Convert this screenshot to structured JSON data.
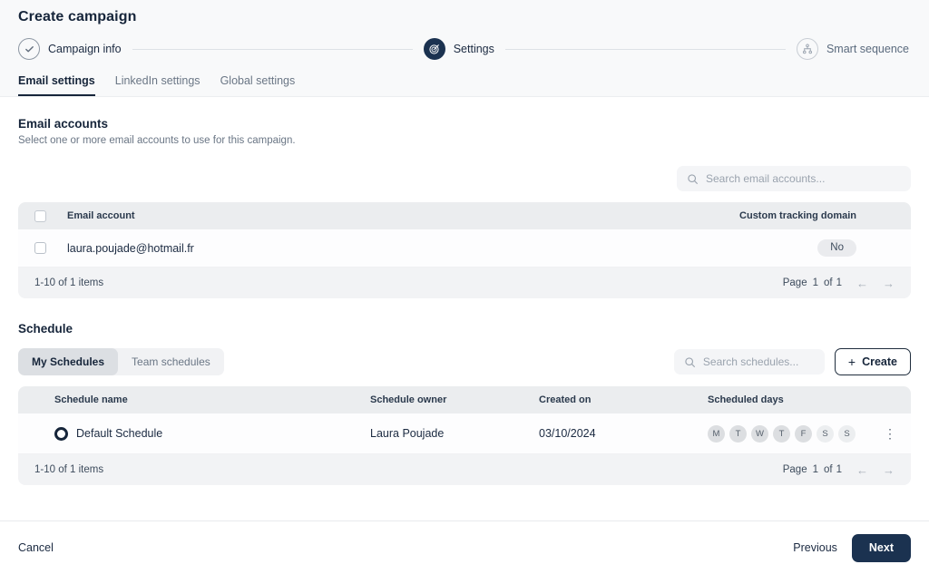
{
  "header": {
    "title": "Create campaign",
    "steps": [
      {
        "label": "Campaign info",
        "state": "done",
        "icon": "check-circle-icon"
      },
      {
        "label": "Settings",
        "state": "active",
        "icon": "target-icon"
      },
      {
        "label": "Smart sequence",
        "state": "upcoming",
        "icon": "sitemap-icon"
      }
    ],
    "tabs": [
      {
        "label": "Email settings",
        "active": true
      },
      {
        "label": "LinkedIn settings",
        "active": false
      },
      {
        "label": "Global settings",
        "active": false
      }
    ]
  },
  "email_accounts": {
    "title": "Email accounts",
    "subtitle": "Select one or more email accounts to use for this campaign.",
    "search_placeholder": "Search email accounts...",
    "search_value": "",
    "search_icon": "search-icon",
    "columns": [
      "Email account",
      "Custom tracking domain"
    ],
    "rows": [
      {
        "email": "laura.poujade@hotmail.fr",
        "tracking_domain": "No",
        "checked": false
      }
    ],
    "footer": {
      "items_label": "1-10 of 1 items",
      "page_word": "Page",
      "page_number": "1",
      "of_word": "of",
      "page_total": "1",
      "prev_icon": "arrow-left-icon",
      "next_icon": "arrow-right-icon"
    }
  },
  "schedule": {
    "title": "Schedule",
    "segments": [
      {
        "label": "My Schedules",
        "active": true
      },
      {
        "label": "Team schedules",
        "active": false
      }
    ],
    "search_placeholder": "Search schedules...",
    "search_value": "",
    "search_icon": "search-icon",
    "create_label": "Create",
    "create_icon": "plus-icon",
    "columns": [
      "Schedule name",
      "Schedule owner",
      "Created on",
      "Scheduled days"
    ],
    "rows": [
      {
        "selected": true,
        "name": "Default Schedule",
        "owner": "Laura Poujade",
        "created_on": "03/10/2024",
        "days": [
          {
            "letter": "M",
            "active": true
          },
          {
            "letter": "T",
            "active": true
          },
          {
            "letter": "W",
            "active": true
          },
          {
            "letter": "T",
            "active": true
          },
          {
            "letter": "F",
            "active": true
          },
          {
            "letter": "S",
            "active": false
          },
          {
            "letter": "S",
            "active": false
          }
        ],
        "menu_icon": "kebab-menu-icon"
      }
    ],
    "footer": {
      "items_label": "1-10 of 1 items",
      "page_word": "Page",
      "page_number": "1",
      "of_word": "of",
      "page_total": "1",
      "prev_icon": "arrow-left-icon",
      "next_icon": "arrow-right-icon"
    }
  },
  "footer": {
    "cancel_label": "Cancel",
    "previous_label": "Previous",
    "next_label": "Next"
  },
  "colors": {
    "accent_navy": "#1b3250",
    "text_primary": "#16253a",
    "text_muted": "#6a7685",
    "table_header_bg": "#ebedef",
    "page_header_bg": "#f8f9fa"
  }
}
